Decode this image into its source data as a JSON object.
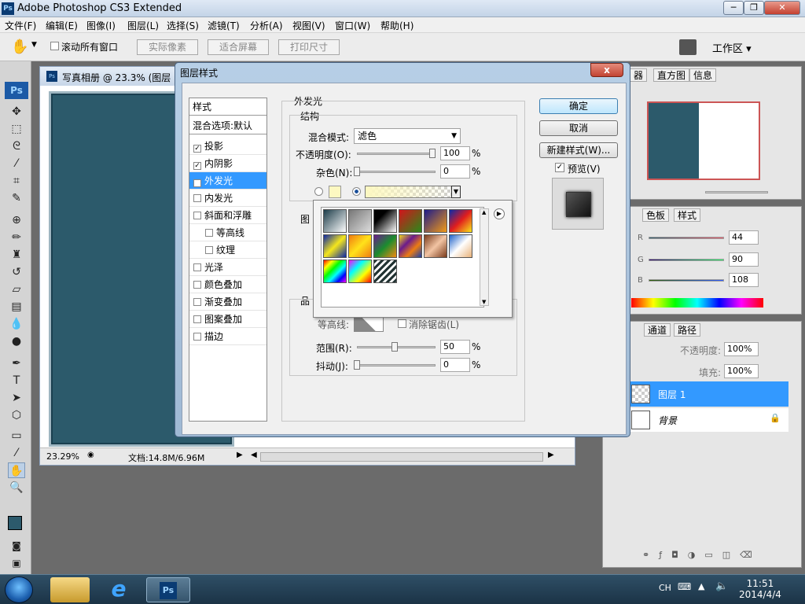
{
  "app": {
    "title": "Adobe Photoshop CS3 Extended",
    "logo": "Ps"
  },
  "menu": [
    "文件(F)",
    "编辑(E)",
    "图像(I)",
    "图层(L)",
    "选择(S)",
    "滤镜(T)",
    "分析(A)",
    "视图(V)",
    "窗口(W)",
    "帮助(H)"
  ],
  "options_bar": {
    "scroll_all": "滚动所有窗口",
    "actual_pixels": "实际像素",
    "fit_screen": "适合屏幕",
    "print_size": "打印尺寸",
    "workspace": "工作区 ▾"
  },
  "document": {
    "title": "写真相册 @ 23.3% (图层",
    "zoom": "23.29%",
    "doc_info": "文档:14.8M/6.96M"
  },
  "dialog": {
    "title": "图层样式",
    "close": "x",
    "styles_header": "样式",
    "blend_default": "混合选项:默认",
    "styles": [
      {
        "label": "投影",
        "checked": true,
        "selected": false,
        "indent": false
      },
      {
        "label": "内阴影",
        "checked": true,
        "selected": false,
        "indent": false
      },
      {
        "label": "外发光",
        "checked": true,
        "selected": true,
        "indent": false
      },
      {
        "label": "内发光",
        "checked": false,
        "selected": false,
        "indent": false
      },
      {
        "label": "斜面和浮雕",
        "checked": false,
        "selected": false,
        "indent": false
      },
      {
        "label": "等高线",
        "checked": false,
        "selected": false,
        "indent": true
      },
      {
        "label": "纹理",
        "checked": false,
        "selected": false,
        "indent": true
      },
      {
        "label": "光泽",
        "checked": false,
        "selected": false,
        "indent": false
      },
      {
        "label": "颜色叠加",
        "checked": false,
        "selected": false,
        "indent": false
      },
      {
        "label": "渐变叠加",
        "checked": false,
        "selected": false,
        "indent": false
      },
      {
        "label": "图案叠加",
        "checked": false,
        "selected": false,
        "indent": false
      },
      {
        "label": "描边",
        "checked": false,
        "selected": false,
        "indent": false
      }
    ],
    "outer_glow": "外发光",
    "structure": "结构",
    "blend_mode_label": "混合模式:",
    "blend_mode_value": "滤色",
    "opacity_label": "不透明度(O):",
    "opacity_value": "100",
    "noise_label": "杂色(N):",
    "noise_value": "0",
    "percent": "%",
    "elements_partial": "图",
    "quality_partial": "品",
    "contour_label": "等高线:",
    "antialias_label": "消除锯齿(L)",
    "range_label": "范围(R):",
    "range_value": "50",
    "jitter_label": "抖动(J):",
    "jitter_value": "0",
    "ok": "确定",
    "cancel": "取消",
    "new_style": "新建样式(W)...",
    "preview": "预览(V)",
    "preview_checked": true
  },
  "gradient_swatches": [
    {
      "name": "foreground-to-background",
      "css": "linear-gradient(135deg,#1d3d4a,#fff)"
    },
    {
      "name": "foreground-to-transparent",
      "css": "linear-gradient(135deg,#777,#ddd)"
    },
    {
      "name": "black-white",
      "css": "linear-gradient(135deg,#000 30%,#fff)"
    },
    {
      "name": "red-green",
      "css": "linear-gradient(135deg,#d2141b,#2a8a1a)"
    },
    {
      "name": "violet-orange",
      "css": "linear-gradient(135deg,#1d1b8a,#f29a17)"
    },
    {
      "name": "blue-red-yellow",
      "css": "linear-gradient(135deg,#0b2aa8,#e11d1d 50%,#f7e71b)"
    },
    {
      "name": "blue-yellow-blue",
      "css": "linear-gradient(135deg,#0c27a6,#f5e61c 50%,#0c27a6)"
    },
    {
      "name": "orange-yellow-orange",
      "css": "linear-gradient(135deg,#f07b11,#ffe21a 50%,#f07b11)"
    },
    {
      "name": "violet-green-orange",
      "css": "linear-gradient(135deg,#6a1b8c,#1b8c2f 50%,#f08b11)"
    },
    {
      "name": "yellow-violet-orange-blue",
      "css": "linear-gradient(135deg,#f3d91b,#6b1b8c 35%,#ec7c12 65%,#1b3fa8)"
    },
    {
      "name": "copper",
      "css": "linear-gradient(135deg,#7a3b1c,#f2c4a3 50%,#7a3b1c)"
    },
    {
      "name": "chrome",
      "css": "linear-gradient(135deg,#1d62c9,#fff 50%,#e8b27a)"
    },
    {
      "name": "spectrum",
      "css": "linear-gradient(135deg,#f00,#ff0,#0f0,#0ff,#00f,#f0f)"
    },
    {
      "name": "transparent-rainbow",
      "css": "linear-gradient(135deg,#f0f,#0ff,#ff0,#f00)"
    },
    {
      "name": "transparent-stripes",
      "css": "repeating-linear-gradient(135deg,#233 0 3px,#fff 3px 6px)"
    }
  ],
  "panels": {
    "navigator_tabs": [
      "器",
      "直方图",
      "信息"
    ],
    "color_tabs": [
      "色板",
      "样式"
    ],
    "color_values": {
      "r": "44",
      "g": "90",
      "b": "108",
      "r_label": "R",
      "g_label": "G",
      "b_label": "B"
    },
    "layers_tabs": [
      "通道",
      "路径"
    ],
    "opacity_label": "不透明度:",
    "opacity_value": "100%",
    "fill_label": "填充:",
    "fill_value": "100%",
    "layers": [
      {
        "name": "图层 1",
        "selected": true
      },
      {
        "name": "背景",
        "selected": false
      }
    ]
  },
  "taskbar": {
    "ps_label": "Ps",
    "lang": "CH",
    "time": "11:51",
    "date": "2014/4/4"
  },
  "colors": {
    "canvas": "#2c5a6b",
    "selection": "#3399ff",
    "foreground": "#2c5a6c"
  }
}
